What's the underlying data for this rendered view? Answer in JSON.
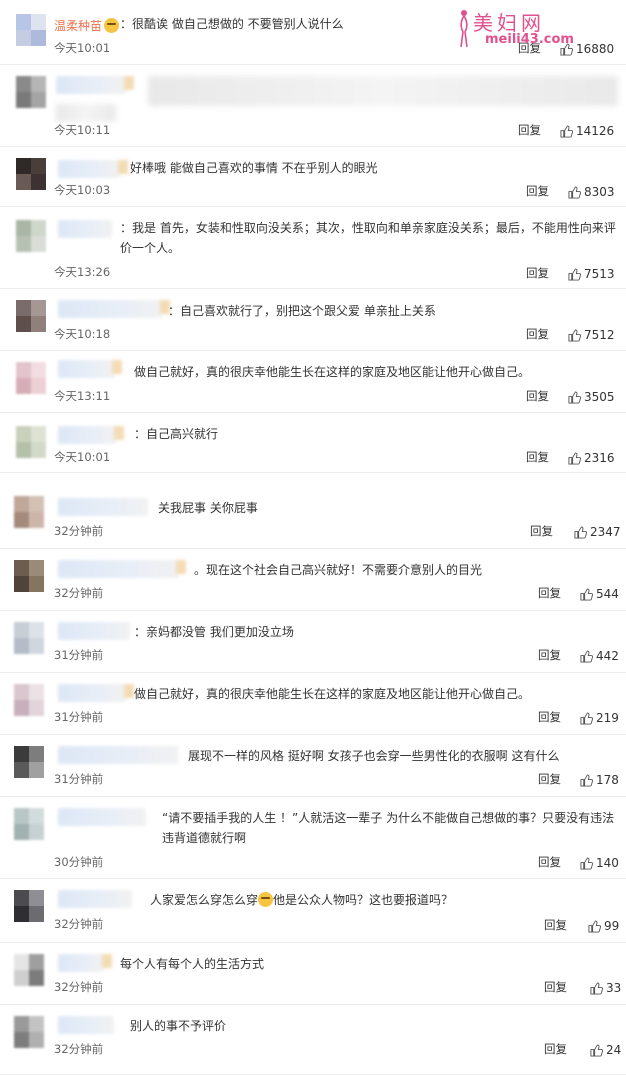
{
  "watermark": {
    "title": "美妇网",
    "url": "meili43.com"
  },
  "reply_label": "回复",
  "comments": [
    {
      "name": "温柔种苗",
      "content": "：很酷诶 做自己想做的 不要管别人说什么",
      "time": "今天10:01",
      "likes": "16880"
    },
    {
      "content": "",
      "time": "今天10:11",
      "likes": "14126"
    },
    {
      "content": "好棒哦 能做自己喜欢的事情 不在乎别人的眼光",
      "time": "今天10:03",
      "likes": "8303"
    },
    {
      "content": "：我是 首先，女装和性取向没关系；其次，性取向和单亲家庭没关系；最后，不能用性向来评价一个人。",
      "time": "今天13:26",
      "likes": "7513"
    },
    {
      "content": "：自己喜欢就行了，别把这个跟父爱 单亲扯上关系",
      "time": "今天10:18",
      "likes": "7512"
    },
    {
      "content": "做自己就好，真的很庆幸他能生长在这样的家庭及地区能让他开心做自己。",
      "time": "今天13:11",
      "likes": "3505"
    },
    {
      "content": "：自己高兴就行",
      "time": "今天10:01",
      "likes": "2316"
    },
    {
      "content": "关我屁事 关你屁事",
      "time": "32分钟前",
      "likes": "2347"
    },
    {
      "content": "。现在这个社会自己高兴就好！不需要介意别人的目光",
      "time": "32分钟前",
      "likes": "544"
    },
    {
      "content": "：亲妈都没管 我们更加没立场",
      "time": "31分钟前",
      "likes": "442"
    },
    {
      "content": "做自己就好，真的很庆幸他能生长在这样的家庭及地区能让他开心做自己。",
      "time": "31分钟前",
      "likes": "219"
    },
    {
      "content": "展现不一样的风格 挺好啊 女孩子也会穿一些男性化的衣服啊 这有什么",
      "time": "31分钟前",
      "likes": "178"
    },
    {
      "content": "“请不要插手我的人生 ！”人就活这一辈子 为什么不能做自己想做的事？只要没有违法违背道德就行啊",
      "time": "30分钟前",
      "likes": "140"
    },
    {
      "content_a": "人家爱怎么穿怎么穿",
      "content_b": "他是公众人物吗？这也要报道吗？",
      "time": "32分钟前",
      "likes": "99"
    },
    {
      "content": "每个人有每个人的生活方式",
      "time": "32分钟前",
      "likes": "33"
    },
    {
      "content": "别人的事不予评价",
      "time": "32分钟前",
      "likes": "24"
    }
  ]
}
